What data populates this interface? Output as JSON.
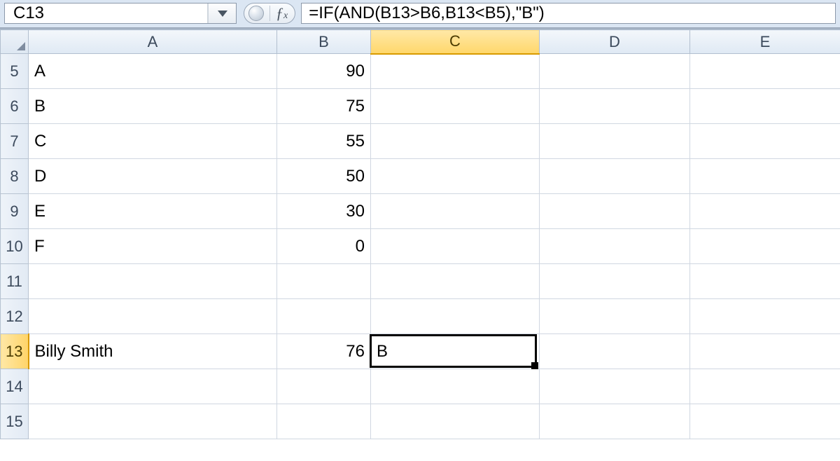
{
  "formula_bar": {
    "name_box": "C13",
    "fx_label": "ƒx",
    "formula": "=IF(AND(B13>B6,B13<B5),\"B\")"
  },
  "columns": [
    "A",
    "B",
    "C",
    "D",
    "E"
  ],
  "selected_column": "C",
  "selected_row": "13",
  "active_cell": {
    "row": "13",
    "col": "C",
    "value": "B"
  },
  "rows": [
    {
      "n": "5",
      "A": "A",
      "B": "90",
      "C": "",
      "D": "",
      "E": ""
    },
    {
      "n": "6",
      "A": "B",
      "B": "75",
      "C": "",
      "D": "",
      "E": ""
    },
    {
      "n": "7",
      "A": "C",
      "B": "55",
      "C": "",
      "D": "",
      "E": ""
    },
    {
      "n": "8",
      "A": "D",
      "B": "50",
      "C": "",
      "D": "",
      "E": ""
    },
    {
      "n": "9",
      "A": "E",
      "B": "30",
      "C": "",
      "D": "",
      "E": ""
    },
    {
      "n": "10",
      "A": "F",
      "B": "0",
      "C": "",
      "D": "",
      "E": ""
    },
    {
      "n": "11",
      "A": "",
      "B": "",
      "C": "",
      "D": "",
      "E": ""
    },
    {
      "n": "12",
      "A": "",
      "B": "",
      "C": "",
      "D": "",
      "E": ""
    },
    {
      "n": "13",
      "A": "Billy Smith",
      "B": "76",
      "C": "B",
      "D": "",
      "E": ""
    },
    {
      "n": "14",
      "A": "",
      "B": "",
      "C": "",
      "D": "",
      "E": ""
    },
    {
      "n": "15",
      "A": "",
      "B": "",
      "C": "",
      "D": "",
      "E": ""
    }
  ]
}
